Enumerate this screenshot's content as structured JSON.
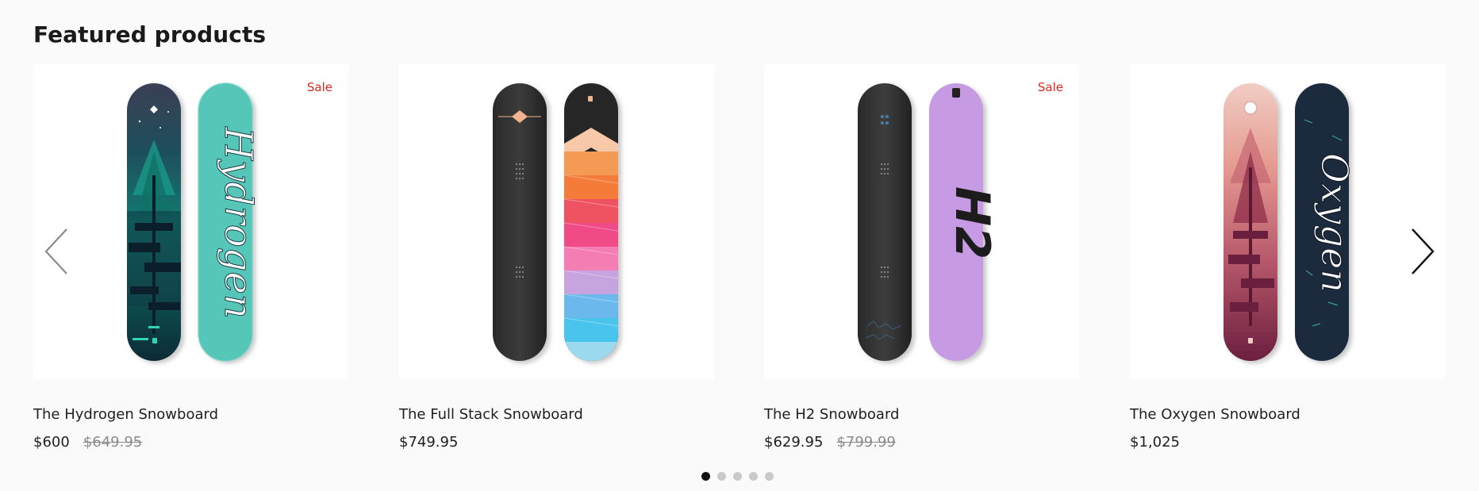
{
  "section": {
    "title": "Featured products"
  },
  "products": [
    {
      "title": "The Hydrogen Snowboard",
      "price": "$600",
      "compare_price": "$649.95",
      "badge": "Sale",
      "board_text": "Hydrogen"
    },
    {
      "title": "The Full Stack Snowboard",
      "price": "$749.95",
      "compare_price": "",
      "badge": ""
    },
    {
      "title": "The H2 Snowboard",
      "price": "$629.95",
      "compare_price": "$799.99",
      "badge": "Sale",
      "board_text": "H2"
    },
    {
      "title": "The Oxygen Snowboard",
      "price": "$1,025",
      "compare_price": "",
      "badge": "",
      "board_text": "Oxygen"
    }
  ],
  "navigation": {
    "prev_icon": "chevron-left-icon",
    "next_icon": "chevron-right-icon"
  },
  "pagination": {
    "count": 5,
    "active_index": 0
  },
  "colors": {
    "background": "#fafafa",
    "card": "#ffffff",
    "sale": "#d92a1e",
    "compare_price": "#8a8a8a",
    "dot_active": "#111111",
    "dot_inactive": "#c9c9c9"
  }
}
